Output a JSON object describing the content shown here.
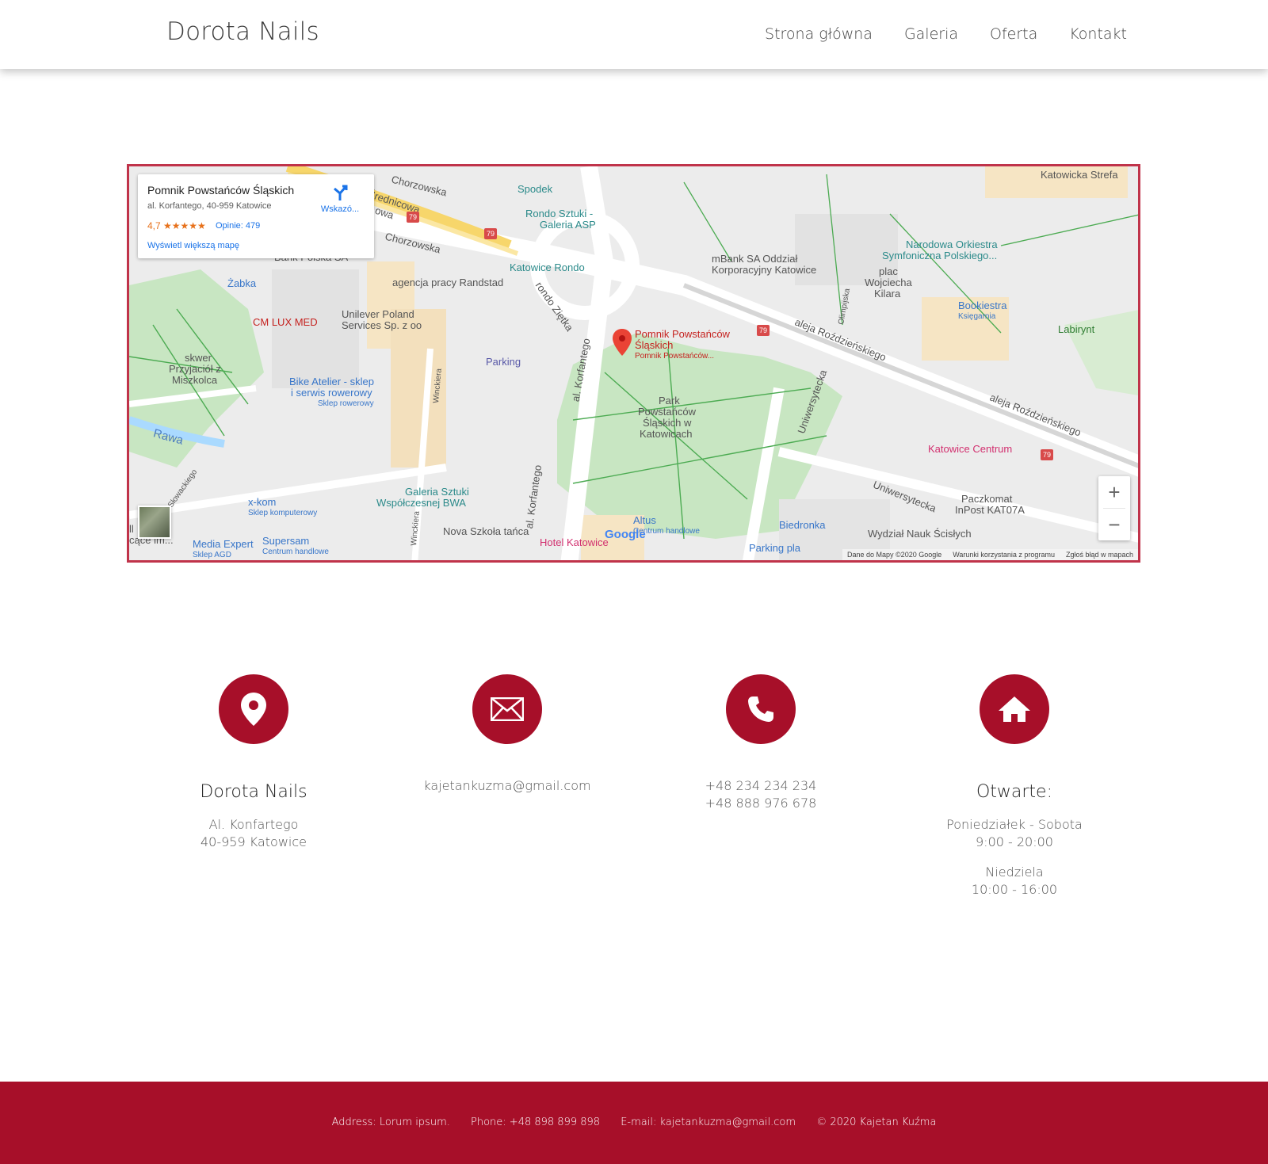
{
  "header": {
    "brand": "Dorota Nails",
    "nav": [
      "Strona główna",
      "Galeria",
      "Oferta",
      "Kontakt"
    ]
  },
  "map": {
    "card": {
      "title": "Pomnik Powstańców Śląskich",
      "address": "al. Korfantego, 40-959 Katowice",
      "rating": "4,7 ★★★★★",
      "reviews": "Opinie: 479",
      "more": "Wyświetl większą mapę",
      "directions": "Wskazó..."
    },
    "labels": {
      "spodek": "Spodek",
      "rondo_sztuki": "Rondo Sztuki -",
      "galeria_asp": "Galeria ASP",
      "katowice_rondo": "Katowice Rondo",
      "chorzowska1": "Chorzowska",
      "chorzowska2": "Chorzowska",
      "srednicowa": "Średnicowa",
      "owa": "owa",
      "bank_polska": "Bank Polska SA",
      "zabka": "Żabka",
      "agencja": "agencja pracy Randstad",
      "unilever": "Unilever Poland",
      "unilever2": "Services Sp. z oo",
      "cmlux": "CM LUX MED",
      "skwer": "skwer",
      "przyjaciol": "Przyjaciół z",
      "miszkolca": "Miszkolca",
      "bike": "Bike Atelier - sklep",
      "bike2": "i serwis rowerowy",
      "bike3": "Sklep rowerowy",
      "parking": "Parking",
      "rondo_zietka": "rondo Ziętka",
      "rawa": "Rawa",
      "slowackiego": "Słowackiego",
      "winclera": "Winckiera",
      "al_korfantego1": "al. Korfantego",
      "al_korfantego2": "al. Korfantego",
      "pomnik": "Pomnik Powstańców",
      "pomnik2": "Śląskich",
      "pomnik3": "Pomnik Powstańców...",
      "park": "Park",
      "park2": "Powstańców",
      "park3": "Śląskich w",
      "park4": "Katowicach",
      "mbank": "mBank SA Oddział",
      "mbank2": "Korporacyjny Katowice",
      "katowicka_strefa": "Katowicka Strefa",
      "narodowa": "Narodowa Orkiestra",
      "narodowa2": "Symfoniczna Polskiego...",
      "plac": "plac",
      "plac2": "Wojciecha",
      "plac3": "Kilara",
      "bookiestra": "Bookiestra",
      "bookiestra2": "Księgarnia",
      "labirynt": "Labirynt",
      "aleja1": "aleja Roździeńskiego",
      "aleja2": "aleja Roździeńskiego",
      "olimpijska": "Olimpijska",
      "uniwersytecka1": "Uniwersytecka",
      "uniwersytecka2": "Uniwersytecka",
      "katowice_centrum": "Katowice Centrum",
      "paczkomat": "Paczkomat",
      "paczkomat2": "InPost KAT07A",
      "wydzial": "Wydział Nauk Ścisłych",
      "biedronka": "Biedronka",
      "parking_pla": "Parking pla",
      "altus": "Altus",
      "altus2": "Centrum handlowe",
      "hotel": "Hotel Katowice",
      "galeria_bwa": "Galeria Sztuki",
      "galeria_bwa2": "Współczesnej BWA",
      "nova": "Nova Szkoła tańca",
      "winckiera2": "Winckiera",
      "xkom": "x-kom",
      "xkom2": "Sklep komputerowy",
      "media": "Media Expert",
      "media2": "Sklep AGD",
      "supersam": "Supersam",
      "supersam2": "Centrum handlowe",
      "sat_label": "cące im...",
      "sat_label2": "ll",
      "r79a": "79",
      "r79b": "79",
      "r79c": "79",
      "r79d": "79"
    },
    "google": "Google",
    "attrib": [
      "Dane do Mapy ©2020 Google",
      "Warunki korzystania z programu",
      "Zgłoś błąd w mapach"
    ],
    "zoom_in": "+",
    "zoom_out": "−"
  },
  "contact": {
    "col1": {
      "heading": "Dorota Nails",
      "line1": "Al. Konfartego",
      "line2": "40-959 Katowice",
      "icon": "location-icon"
    },
    "col2": {
      "email": "kajetankuzma@gmail.com",
      "icon": "envelope-icon"
    },
    "col3": {
      "phone1": "+48 234 234 234",
      "phone2": "+48 888 976 678",
      "icon": "phone-icon"
    },
    "col4": {
      "heading": "Otwarte:",
      "days1": "Poniedziałek - Sobota",
      "hours1": "9:00 - 20:00",
      "days2": "Niedziela",
      "hours2": "10:00 - 16:00",
      "icon": "home-icon"
    }
  },
  "footer": {
    "address": "Address: Lorum ipsum.",
    "phone": "Phone: +48 898 899 898",
    "email": "E-mail: kajetankuzma@gmail.com",
    "copyright": "© 2020 Kajetan Kuźma"
  },
  "colors": {
    "accent": "#a70f29",
    "map_border": "#c0334a"
  }
}
